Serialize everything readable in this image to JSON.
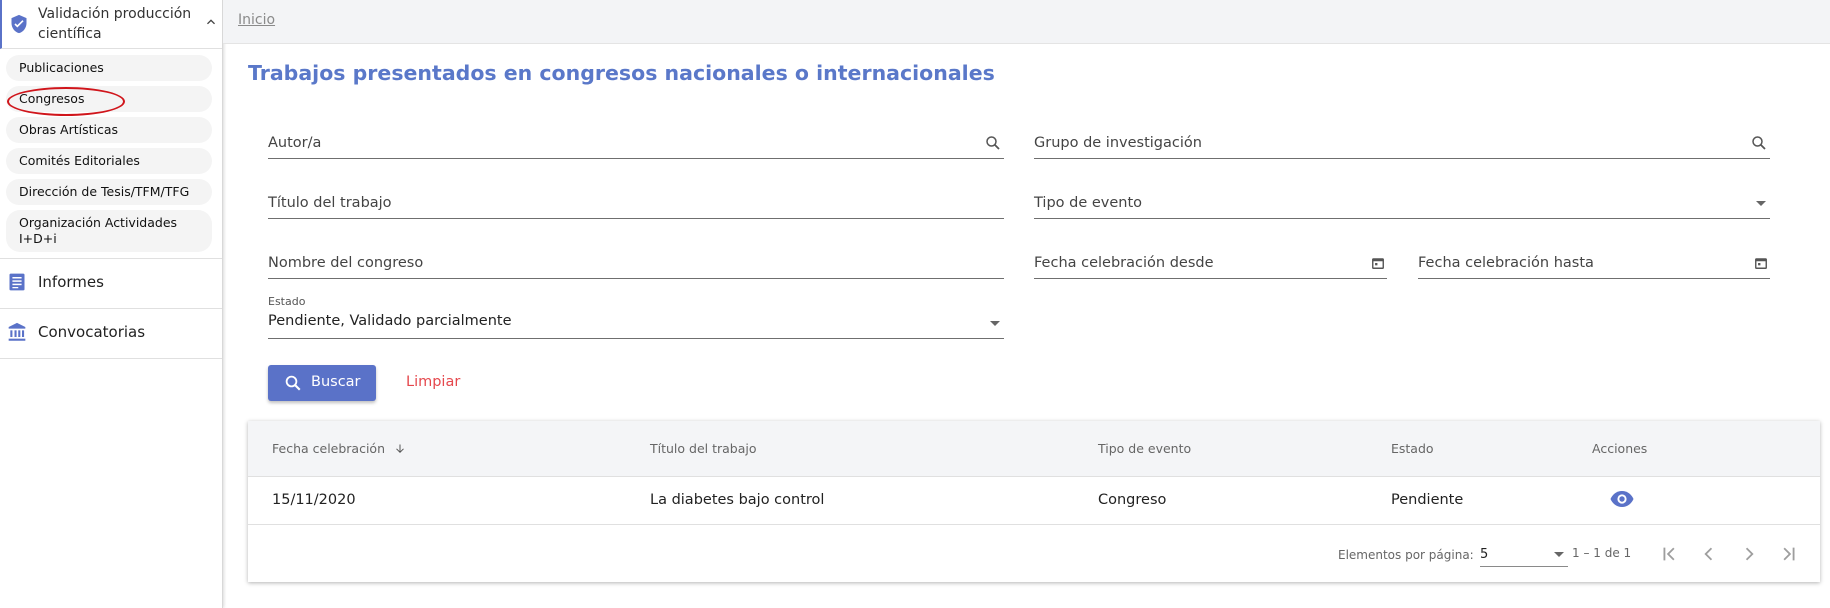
{
  "sidebar": {
    "header_title": "Validación producción científica",
    "sub_items": [
      {
        "label": "Publicaciones"
      },
      {
        "label": "Congresos"
      },
      {
        "label": "Obras Artísticas"
      },
      {
        "label": "Comités Editoriales"
      },
      {
        "label": "Dirección de Tesis/TFM/TFG"
      },
      {
        "label": "Organización Actividades I+D+i"
      }
    ],
    "main_items": [
      {
        "label": "Informes",
        "icon": "list-icon"
      },
      {
        "label": "Convocatorias",
        "icon": "bank-icon"
      }
    ]
  },
  "breadcrumb": {
    "home": "Inicio"
  },
  "page": {
    "title": "Trabajos presentados en congresos nacionales o internacionales"
  },
  "form": {
    "autor_placeholder": "Autor/a",
    "grupo_placeholder": "Grupo de investigación",
    "titulo_placeholder": "Título del trabajo",
    "tipo_placeholder": "Tipo de evento",
    "congreso_placeholder": "Nombre del congreso",
    "fecha_desde_placeholder": "Fecha celebración desde",
    "fecha_hasta_placeholder": "Fecha celebración hasta",
    "estado_label": "Estado",
    "estado_value": "Pendiente, Validado parcialmente",
    "buscar_label": "Buscar",
    "limpiar_label": "Limpiar"
  },
  "table": {
    "columns": [
      "Fecha celebración",
      "Título del trabajo",
      "Tipo de evento",
      "Estado",
      "Acciones"
    ],
    "rows": [
      {
        "fecha": "15/11/2020",
        "titulo": "La diabetes bajo control",
        "tipo": "Congreso",
        "estado": "Pendiente"
      }
    ],
    "paginator": {
      "label": "Elementos por página:",
      "page_size": "5",
      "range": "1 – 1 de 1"
    }
  },
  "colors": {
    "accent": "#5a72c8",
    "title": "#5a78c9",
    "danger": "#e5484d",
    "highlight": "#d0151b"
  }
}
